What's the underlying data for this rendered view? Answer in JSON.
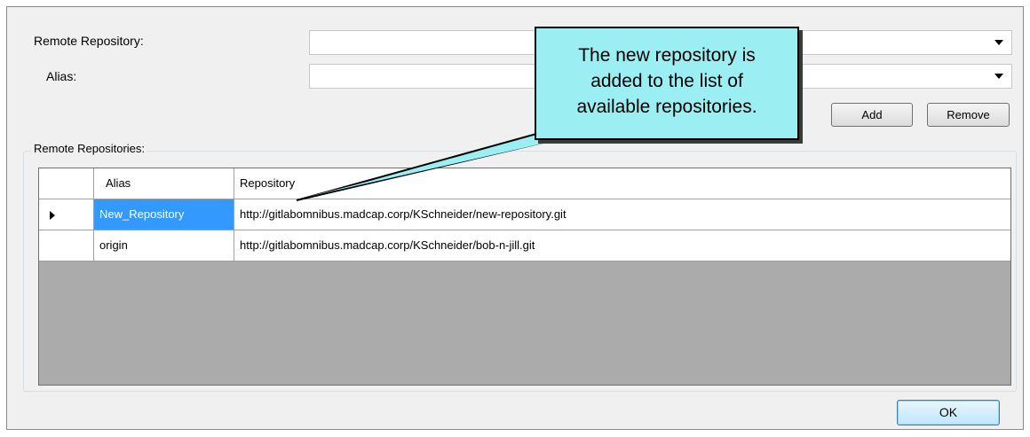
{
  "form": {
    "remote_repository_label": "Remote Repository:",
    "remote_repository_value": "",
    "alias_label": "Alias:",
    "alias_value": ""
  },
  "buttons": {
    "add": "Add",
    "remove": "Remove",
    "ok": "OK"
  },
  "repositories_group": {
    "title": "Remote Repositories:",
    "columns": [
      "Alias",
      "Repository"
    ],
    "rows": [
      {
        "alias": "New_Repository",
        "repository": "http://gitlabomnibus.madcap.corp/KSchneider/new-repository.git",
        "selected": true
      },
      {
        "alias": "origin",
        "repository": "http://gitlabomnibus.madcap.corp/KSchneider/bob-n-jill.git",
        "selected": false
      }
    ]
  },
  "callout": {
    "lines": [
      "The new repository is",
      "added to the list of",
      "available repositories."
    ],
    "fill_color": "#9beff2"
  },
  "icons": {
    "dropdown": "chevron-down-icon",
    "current_row": "row-pointer-icon"
  }
}
